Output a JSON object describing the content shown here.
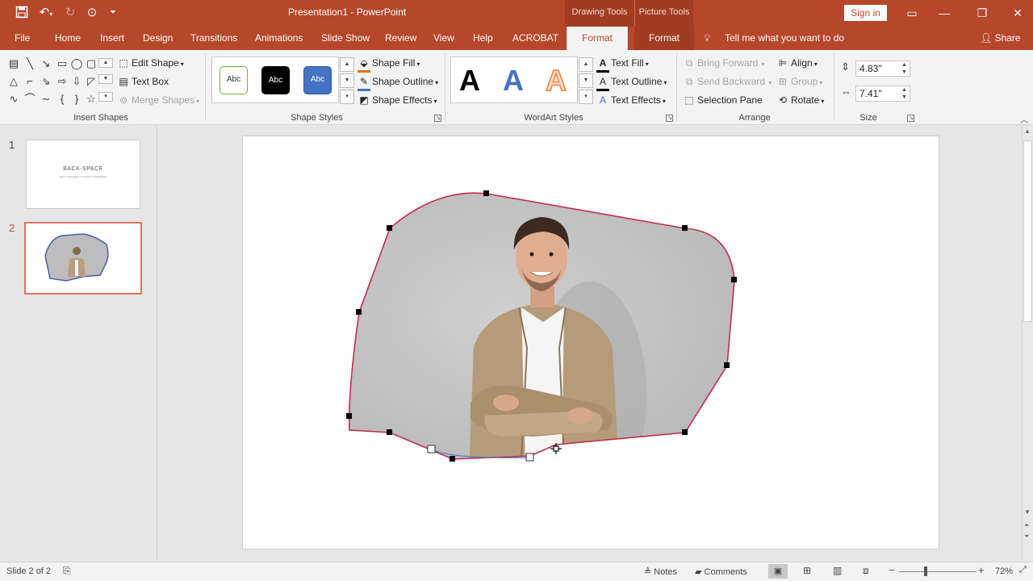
{
  "app": {
    "title": "Presentation1  -  PowerPoint",
    "sign_in": "Sign in",
    "context_drawing": "Drawing Tools",
    "context_picture": "Picture Tools"
  },
  "tabs": [
    "File",
    "Home",
    "Insert",
    "Design",
    "Transitions",
    "Animations",
    "Slide Show",
    "Review",
    "View",
    "Help",
    "ACROBAT"
  ],
  "tab_format_drawing": "Format",
  "tab_format_picture": "Format",
  "tell_me": "Tell me what you want to do",
  "share": "Share",
  "ribbon": {
    "insert_shapes": {
      "label": "Insert Shapes",
      "edit_shape": "Edit Shape",
      "text_box": "Text Box",
      "merge_shapes": "Merge Shapes"
    },
    "shape_styles": {
      "label": "Shape Styles",
      "style1": "Abc",
      "style2": "Abc",
      "style3": "Abc",
      "shape_fill": "Shape Fill",
      "shape_outline": "Shape Outline",
      "shape_effects": "Shape Effects"
    },
    "wordart": {
      "label": "WordArt Styles",
      "letter1": "A",
      "letter2": "A",
      "letter3": "A",
      "text_fill": "Text Fill",
      "text_outline": "Text Outline",
      "text_effects": "Text Effects"
    },
    "arrange": {
      "label": "Arrange",
      "bring_forward": "Bring Forward",
      "send_backward": "Send Backward",
      "selection_pane": "Selection Pane",
      "align": "Align",
      "group": "Group",
      "rotate": "Rotate"
    },
    "size": {
      "label": "Size",
      "height": "4.83\"",
      "width": "7.41\""
    }
  },
  "slides": [
    {
      "number": "1",
      "title": "BACK-SPACE",
      "subtitle": "How to edit points of a picture in PowerPoint"
    },
    {
      "number": "2"
    }
  ],
  "status": {
    "slide_of": "Slide 2 of 2",
    "notes": "Notes",
    "comments": "Comments",
    "zoom": "72%"
  },
  "colors": {
    "accent": "#b7472a",
    "shape_outline": "#c0304a",
    "photo_bg": "#c4c4c4"
  }
}
